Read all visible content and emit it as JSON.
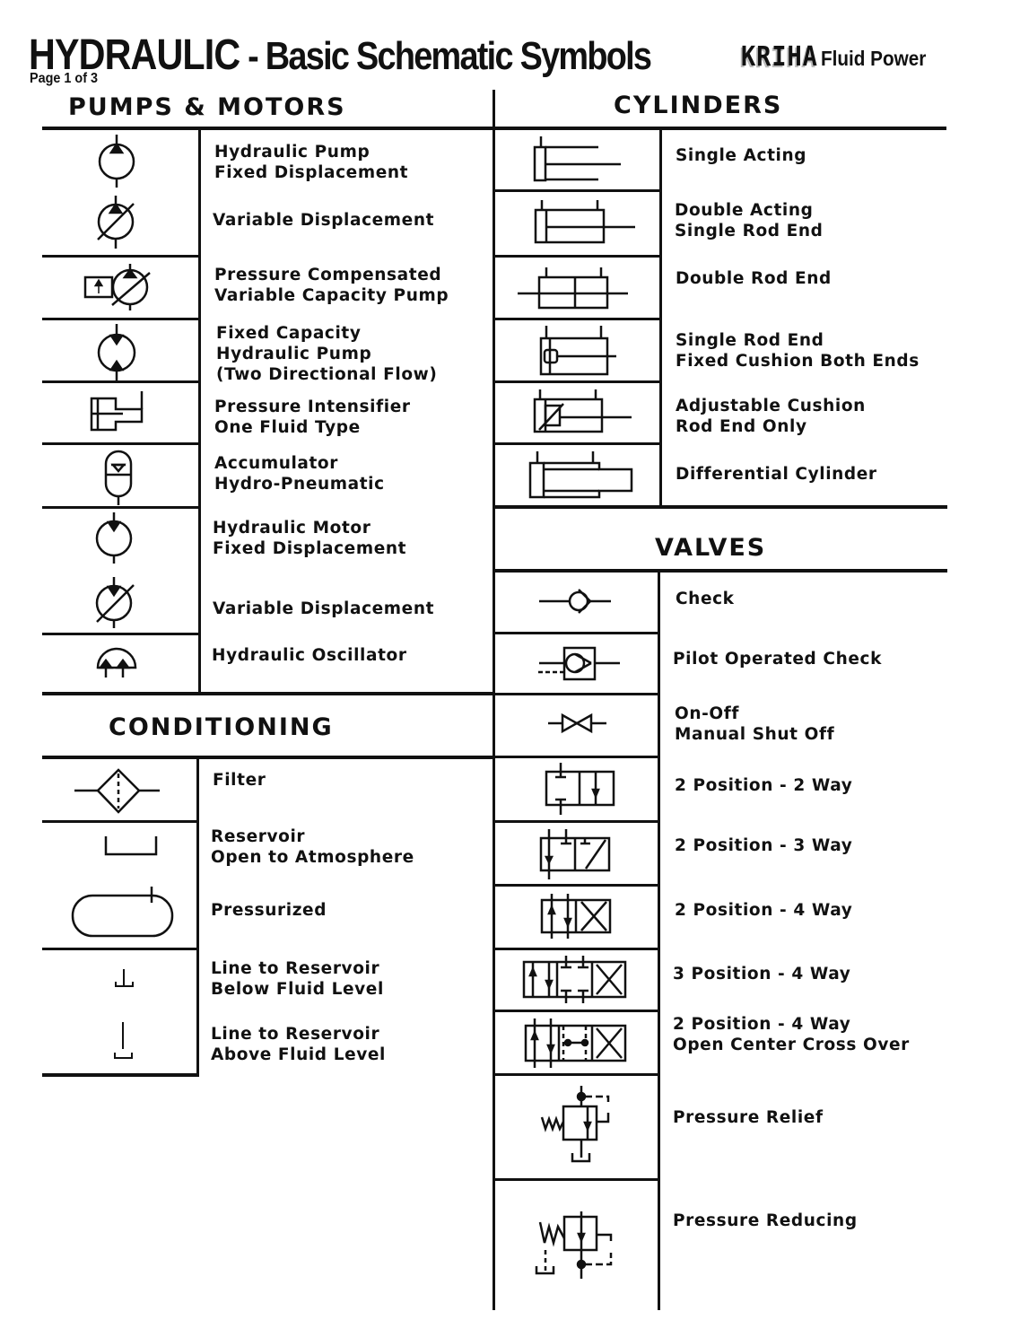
{
  "header": {
    "title_main": "HYDRAULIC",
    "title_rest": " - Basic Schematic Symbols",
    "page_label": "Page 1 of 3",
    "brand_logo": "KRIHA",
    "brand_suffix": "Fluid Power"
  },
  "sections": {
    "pumps_motors": {
      "heading": "PUMPS  &  MOTORS",
      "items": [
        {
          "symbol": "hydraulic-pump-fixed-icon",
          "lines": [
            "Hydraulic Pump",
            "Fixed Displacement"
          ]
        },
        {
          "symbol": "hydraulic-pump-variable-icon",
          "lines": [
            "Variable Displacement"
          ]
        },
        {
          "symbol": "pressure-compensated-pump-icon",
          "lines": [
            "Pressure Compensated",
            "Variable Capacity Pump"
          ]
        },
        {
          "symbol": "bidirectional-pump-icon",
          "lines": [
            "Fixed Capacity",
            "Hydraulic Pump",
            "(Two Directional Flow)"
          ]
        },
        {
          "symbol": "pressure-intensifier-icon",
          "lines": [
            "Pressure Intensifier",
            "One Fluid Type"
          ]
        },
        {
          "symbol": "accumulator-icon",
          "lines": [
            "Accumulator",
            "Hydro-Pneumatic"
          ]
        },
        {
          "symbol": "hydraulic-motor-fixed-icon",
          "lines": [
            "Hydraulic Motor",
            "Fixed Displacement"
          ]
        },
        {
          "symbol": "hydraulic-motor-variable-icon",
          "lines": [
            "Variable Displacement"
          ]
        },
        {
          "symbol": "hydraulic-oscillator-icon",
          "lines": [
            "Hydraulic Oscillator"
          ]
        }
      ]
    },
    "conditioning": {
      "heading": "CONDITIONING",
      "items": [
        {
          "symbol": "filter-icon",
          "lines": [
            "Filter"
          ]
        },
        {
          "symbol": "reservoir-open-icon",
          "lines": [
            "Reservoir",
            "Open to Atmosphere"
          ]
        },
        {
          "symbol": "reservoir-pressurized-icon",
          "lines": [
            "Pressurized"
          ]
        },
        {
          "symbol": "line-below-fluid-icon",
          "lines": [
            "Line to Reservoir",
            "Below Fluid Level"
          ]
        },
        {
          "symbol": "line-above-fluid-icon",
          "lines": [
            "Line to Reservoir",
            "Above Fluid Level"
          ]
        }
      ]
    },
    "cylinders": {
      "heading": "CYLINDERS",
      "items": [
        {
          "symbol": "single-acting-cylinder-icon",
          "lines": [
            "Single Acting"
          ]
        },
        {
          "symbol": "double-acting-cylinder-icon",
          "lines": [
            "Double Acting",
            "Single Rod End"
          ]
        },
        {
          "symbol": "double-rod-cylinder-icon",
          "lines": [
            "Double Rod End"
          ]
        },
        {
          "symbol": "fixed-cushion-cylinder-icon",
          "lines": [
            "Single Rod End",
            "Fixed Cushion Both Ends"
          ]
        },
        {
          "symbol": "adjustable-cushion-cylinder-icon",
          "lines": [
            "Adjustable Cushion",
            "Rod End Only"
          ]
        },
        {
          "symbol": "differential-cylinder-icon",
          "lines": [
            "Differential Cylinder"
          ]
        }
      ]
    },
    "valves": {
      "heading": "VALVES",
      "items": [
        {
          "symbol": "check-valve-icon",
          "lines": [
            "Check"
          ]
        },
        {
          "symbol": "pilot-check-valve-icon",
          "lines": [
            "Pilot Operated Check"
          ]
        },
        {
          "symbol": "shutoff-valve-icon",
          "lines": [
            "On-Off",
            "Manual Shut Off"
          ]
        },
        {
          "symbol": "valve-2pos-2way-icon",
          "lines": [
            "2 Position - 2 Way"
          ]
        },
        {
          "symbol": "valve-2pos-3way-icon",
          "lines": [
            "2 Position - 3 Way"
          ]
        },
        {
          "symbol": "valve-2pos-4way-icon",
          "lines": [
            "2 Position - 4 Way"
          ]
        },
        {
          "symbol": "valve-3pos-4way-icon",
          "lines": [
            "3 Position - 4 Way"
          ]
        },
        {
          "symbol": "valve-open-center-icon",
          "lines": [
            "2 Position - 4 Way",
            "Open Center Cross Over"
          ]
        },
        {
          "symbol": "pressure-relief-valve-icon",
          "lines": [
            "Pressure Relief"
          ]
        },
        {
          "symbol": "pressure-reducing-valve-icon",
          "lines": [
            "Pressure Reducing"
          ]
        }
      ]
    }
  }
}
